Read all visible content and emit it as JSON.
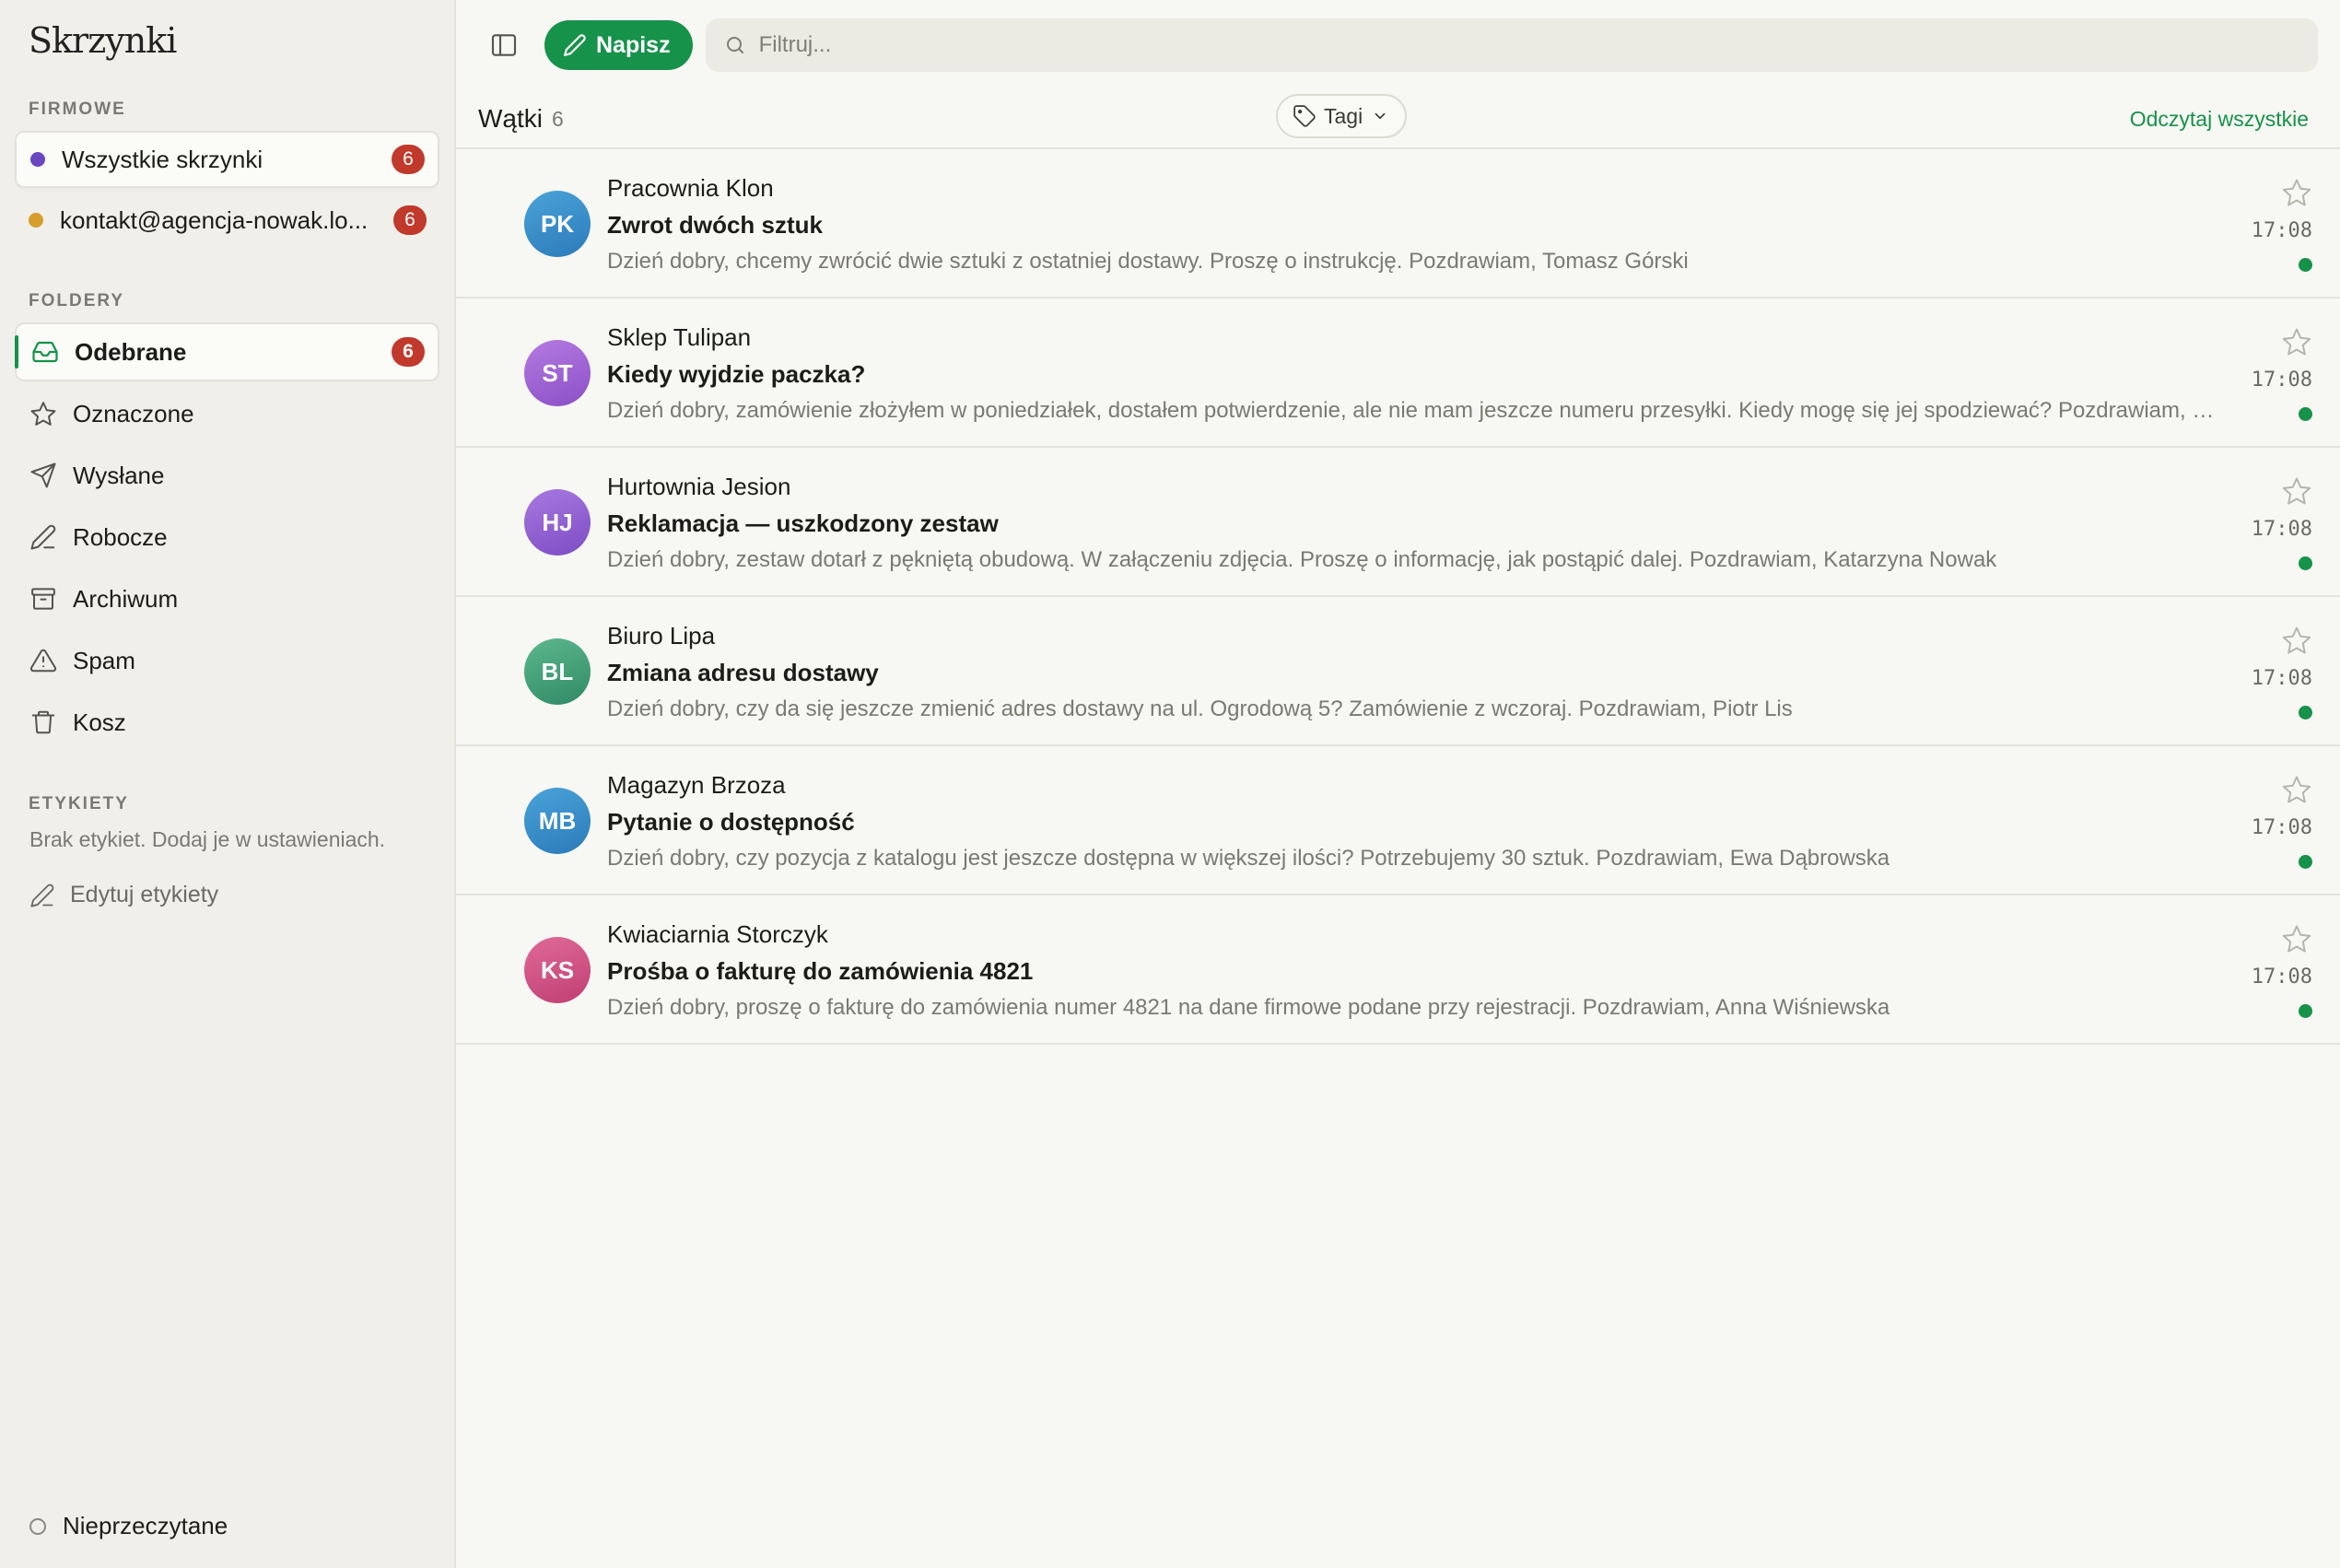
{
  "sidebar": {
    "app_title": "Skrzynki",
    "accounts_label": "FIRMOWE",
    "accounts": [
      {
        "label": "Wszystkie skrzynki",
        "badge": "6",
        "dot_color": "#6b46c1",
        "active": true
      },
      {
        "label": "kontakt@agencja-nowak.lo...",
        "badge": "6",
        "dot_color": "#d69e2e",
        "active": false
      }
    ],
    "folders_label": "FOLDERY",
    "folders": [
      {
        "label": "Odebrane",
        "icon": "inbox-icon",
        "badge": "6",
        "active": true
      },
      {
        "label": "Oznaczone",
        "icon": "star-icon"
      },
      {
        "label": "Wysłane",
        "icon": "send-icon"
      },
      {
        "label": "Robocze",
        "icon": "pencil-icon"
      },
      {
        "label": "Archiwum",
        "icon": "archive-icon"
      },
      {
        "label": "Spam",
        "icon": "warning-icon"
      },
      {
        "label": "Kosz",
        "icon": "trash-icon"
      }
    ],
    "labels_label": "ETYKIETY",
    "labels_empty": "Brak etykiet. Dodaj je w ustawieniach.",
    "edit_labels": "Edytuj etykiety",
    "unread_filter": "Nieprzeczytane"
  },
  "toolbar": {
    "compose_label": "Napisz",
    "filter_placeholder": "Filtruj..."
  },
  "list": {
    "title": "Wątki",
    "count": "6",
    "tags_label": "Tagi",
    "read_all": "Odczytaj wszystkie"
  },
  "colors": {
    "accent": "#17924a",
    "badge": "#c0392b"
  },
  "threads": [
    {
      "initials": "PK",
      "sender": "Pracownia Klon",
      "subject": "Zwrot dwóch sztuk",
      "preview": "Dzień dobry, chcemy zwrócić dwie sztuki z ostatniej dostawy. Proszę o instrukcję. Pozdrawiam, Tomasz Górski",
      "time": "17:08",
      "avatar_from": "#4aa3d8",
      "avatar_to": "#2b7bb9",
      "unread": true
    },
    {
      "initials": "ST",
      "sender": "Sklep Tulipan",
      "subject": "Kiedy wyjdzie paczka?",
      "preview": "Dzień dobry, zamówienie złożyłem w poniedziałek, dostałem potwierdzenie, ale nie mam jeszcze numeru przesyłki. Kiedy mogę się jej spodziewać? Pozdrawiam, Michał Kowalczyk",
      "time": "17:08",
      "avatar_from": "#b57be0",
      "avatar_to": "#8b4fc7",
      "unread": true
    },
    {
      "initials": "HJ",
      "sender": "Hurtownia Jesion",
      "subject": "Reklamacja — uszkodzony zestaw",
      "preview": "Dzień dobry, zestaw dotarł z pękniętą obudową. W załączeniu zdjęcia. Proszę o informację, jak postąpić dalej. Pozdrawiam, Katarzyna Nowak",
      "time": "17:08",
      "avatar_from": "#a979e0",
      "avatar_to": "#7c4cc4",
      "unread": true
    },
    {
      "initials": "BL",
      "sender": "Biuro Lipa",
      "subject": "Zmiana adresu dostawy",
      "preview": "Dzień dobry, czy da się jeszcze zmienić adres dostawy na ul. Ogrodową 5? Zamówienie z wczoraj. Pozdrawiam, Piotr Lis",
      "time": "17:08",
      "avatar_from": "#5db88e",
      "avatar_to": "#2f8a64",
      "unread": true
    },
    {
      "initials": "MB",
      "sender": "Magazyn Brzoza",
      "subject": "Pytanie o dostępność",
      "preview": "Dzień dobry, czy pozycja z katalogu jest jeszcze dostępna w większej ilości? Potrzebujemy 30 sztuk. Pozdrawiam, Ewa Dąbrowska",
      "time": "17:08",
      "avatar_from": "#4aa3d8",
      "avatar_to": "#2b7bb9",
      "unread": true
    },
    {
      "initials": "KS",
      "sender": "Kwiaciarnia Storczyk",
      "subject": "Prośba o fakturę do zamówienia 4821",
      "preview": "Dzień dobry, proszę o fakturę do zamówienia numer 4821 na dane firmowe podane przy rejestracji. Pozdrawiam, Anna Wiśniewska",
      "time": "17:08",
      "avatar_from": "#e06a98",
      "avatar_to": "#bf3f72",
      "unread": true
    }
  ]
}
